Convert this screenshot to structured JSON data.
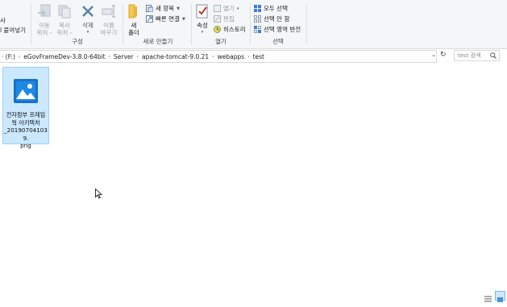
{
  "ribbon": {
    "clipboard_partial": {
      "top": "사",
      "paste_label": "l 붙여넣기"
    },
    "organize": {
      "group_label": "구성",
      "move_to": "이동\n위치 -",
      "copy_to": "복사\n위치 -",
      "delete": "삭제",
      "delete_caret": "▾",
      "rename": "이름\n바꾸기"
    },
    "new": {
      "group_label": "새로 만들기",
      "new_folder": "새\n폴더",
      "new_item": "새 항목",
      "easy_access": "빠른 연결"
    },
    "open": {
      "group_label": "열기",
      "properties": "속성",
      "open_btn": "열기",
      "edit_btn": "편집",
      "history_btn": "히스토리"
    },
    "select": {
      "group_label": "선택",
      "select_all": "모두 선택",
      "select_none": "선택 안 함",
      "invert": "선택 영역 반전"
    }
  },
  "address": {
    "prefix": "· (F:)",
    "crumbs": [
      "eGovFrameDev-3.8.0-64bit",
      "Server",
      "apache-tomcat-9.0.21",
      "webapps",
      "test"
    ],
    "separator": "›",
    "search_placeholder": "test 검색"
  },
  "files": [
    {
      "name": "전자정부 프레임웍 아키텍처_201907041039.png",
      "name_lines": [
        "전자정부 프레임",
        "웍 아키텍처",
        "_201907041039.",
        "png"
      ],
      "selected": true
    }
  ],
  "colors": {
    "accent": "#0078d7",
    "selection_bg": "#cce8ff",
    "selection_border": "#99d1ff"
  }
}
